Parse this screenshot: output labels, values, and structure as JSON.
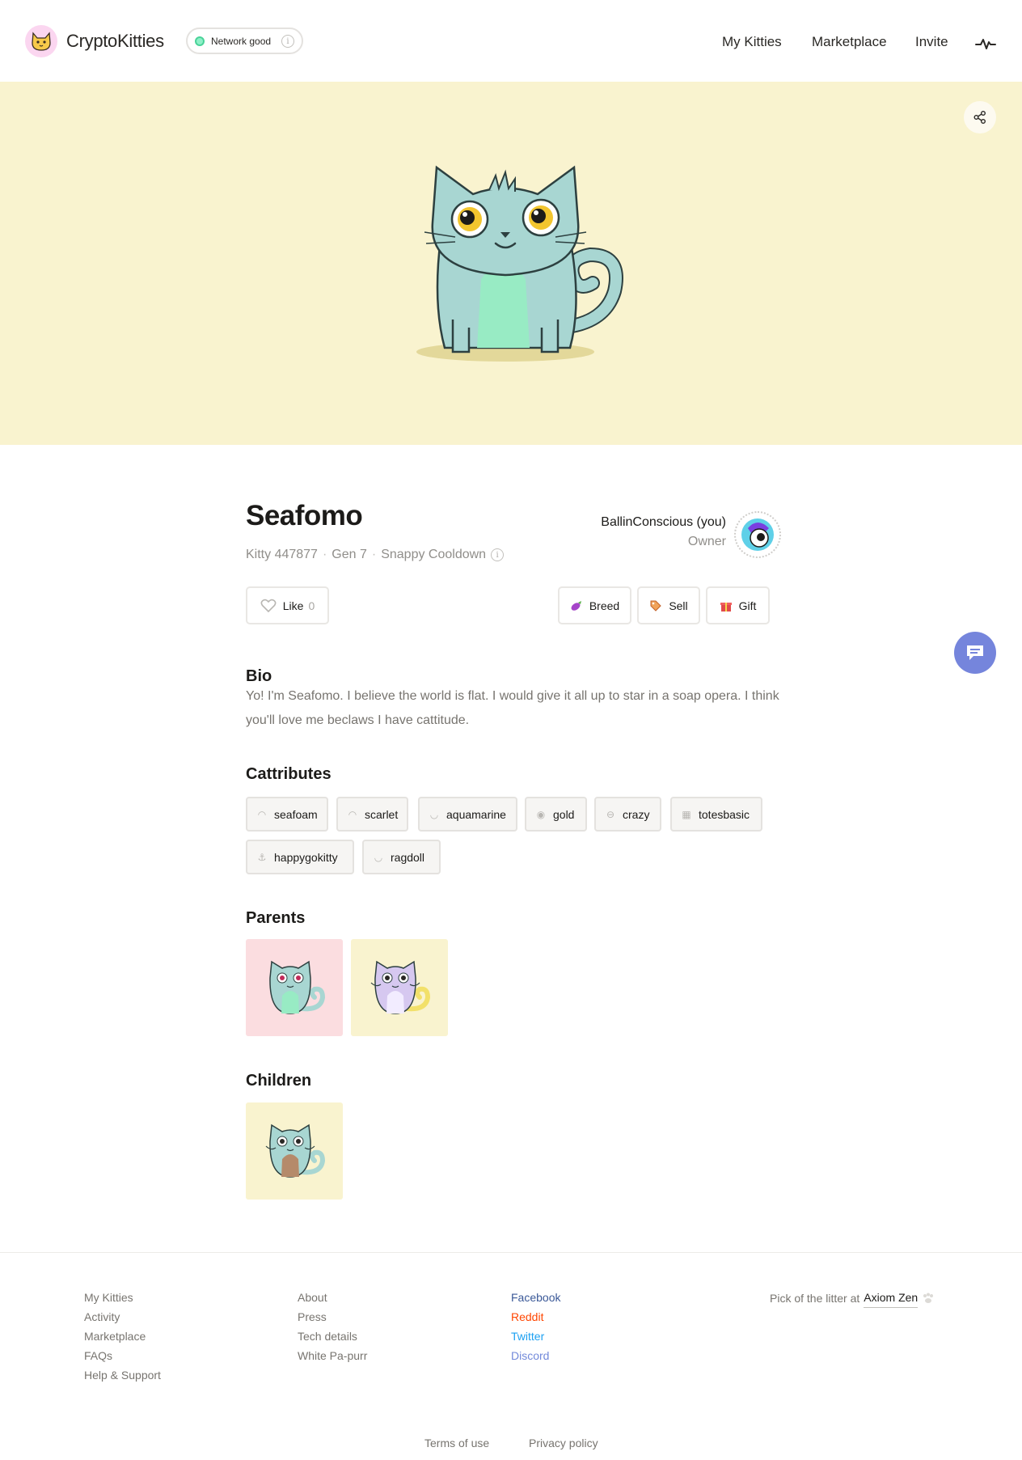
{
  "header": {
    "brand": "CryptoKitties",
    "network_status": "Network good",
    "nav": [
      "My Kitties",
      "Marketplace",
      "Invite"
    ],
    "activity_icon": "pulse-icon"
  },
  "hero": {
    "background": "#f9f3cf",
    "share_icon": "share-icon"
  },
  "kitty": {
    "name": "Seafomo",
    "id_text": "Kitty 447877",
    "gen_text": "Gen 7",
    "cooldown_text": "Snappy Cooldown",
    "owner_name": "BallinConscious (you)",
    "owner_role": "Owner"
  },
  "actions": {
    "like_label": "Like",
    "like_count": "0",
    "breed_label": "Breed",
    "sell_label": "Sell",
    "gift_label": "Gift"
  },
  "bio": {
    "heading": "Bio",
    "text": "Yo! I'm Seafomo. I believe the world is flat. I would give it all up to star in a soap opera. I think you'll love me beclaws I have cattitude."
  },
  "cattributes": {
    "heading": "Cattributes",
    "items": [
      {
        "label": "seafoam",
        "icon": "pattern-icon"
      },
      {
        "label": "scarlet",
        "icon": "pattern-icon"
      },
      {
        "label": "aquamarine",
        "icon": "body-icon"
      },
      {
        "label": "gold",
        "icon": "eye-color-icon"
      },
      {
        "label": "crazy",
        "icon": "eye-shape-icon"
      },
      {
        "label": "totesbasic",
        "icon": "pattern-grid-icon"
      },
      {
        "label": "happygokitty",
        "icon": "mouth-icon"
      },
      {
        "label": "ragdoll",
        "icon": "body-icon"
      }
    ]
  },
  "parents": {
    "heading": "Parents",
    "cards": [
      {
        "background": "#fbdde0"
      },
      {
        "background": "#f9f3cf"
      }
    ]
  },
  "children": {
    "heading": "Children",
    "cards": [
      {
        "background": "#f9f3cf"
      }
    ]
  },
  "footer": {
    "col1": [
      "My Kitties",
      "Activity",
      "Marketplace",
      "FAQs",
      "Help & Support"
    ],
    "col2": [
      "About",
      "Press",
      "Tech details",
      "White Pa-purr"
    ],
    "col3": [
      "Facebook",
      "Reddit",
      "Twitter",
      "Discord"
    ],
    "litter_text": "Pick of the litter at",
    "litter_link": "Axiom Zen",
    "terms": "Terms of use",
    "privacy": "Privacy policy"
  },
  "colors": {
    "accent_chat": "#7585dc",
    "network_good": "#4ad399"
  }
}
